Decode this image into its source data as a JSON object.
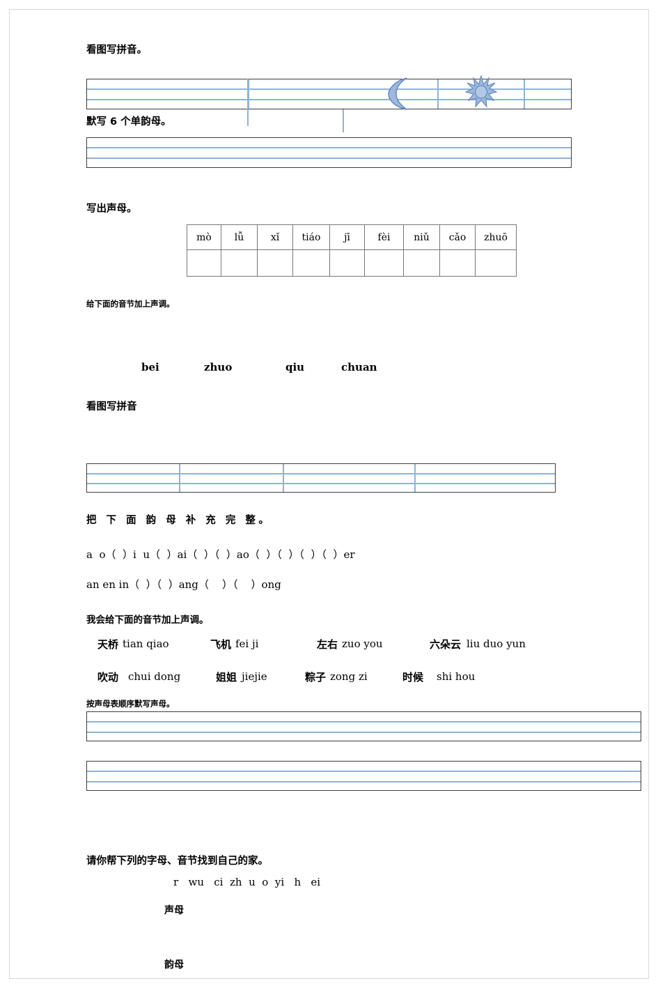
{
  "document": {
    "title": "一年级拼音练习题",
    "page_background": "#ffffff",
    "grid_line_color": "#8db3de",
    "grid_border_color": "#3c3c3c",
    "table_border_color": "#777777",
    "artwork_color": "#9cb8dc"
  },
  "sections": {
    "s1_heading": "看图写拼音。",
    "s2_heading": "默写 6 个单韵母。",
    "s3_heading": "写出声母。",
    "s4_heading": "给下面的音节加上声调。",
    "s5_heading": "看图写拼音",
    "s6_heading": "把 下 面 韵 母 补 充 完 整。",
    "s7_heading": "我会给下面的音节加上声调。",
    "s8_heading": "按声母表顺序默写声母。",
    "s9_heading": "请你帮下列的字母、音节找到自己的家。"
  },
  "pinyin_table": {
    "syllables": [
      "mò",
      "lǚ",
      "xǐ",
      "tiáo",
      "jī",
      "fèi",
      "niǔ",
      "cǎo",
      "zhuō"
    ],
    "answer_row": [
      "",
      "",
      "",
      "",
      "",
      "",
      "",
      "",
      ""
    ]
  },
  "tone_exercise_1": {
    "items": [
      "bei",
      "zhuo",
      "qiu",
      "chuan"
    ]
  },
  "finals_completion": {
    "line1": "a  o（  ）i  u（  ）ai（  ）（  ）ao（  ）（  ）（  ）（  ）er",
    "line2": "an en in（  ）（  ）ang（    ）（    ）ong"
  },
  "tone_exercise_2": {
    "row1": [
      {
        "word": "天桥",
        "pinyin": "tian qiao"
      },
      {
        "word": "飞机",
        "pinyin": "fei ji"
      },
      {
        "word": "左右",
        "pinyin": "zuo you"
      },
      {
        "word": "六朵云",
        "pinyin": "liu duo yun"
      }
    ],
    "row2": [
      {
        "word": "吹动",
        "pinyin": "chui dong"
      },
      {
        "word": "姐姐",
        "pinyin": "jiejie"
      },
      {
        "word": "粽子",
        "pinyin": "zong zi"
      },
      {
        "word": "时候",
        "pinyin": "shi hou"
      }
    ]
  },
  "sorting_exercise": {
    "letters": [
      "r",
      "wu",
      "ci",
      "zh",
      "u",
      "o",
      "yi",
      "h",
      "ei"
    ],
    "letters_line": "r   wu   ci  zh  u  o  yi   h   ei",
    "category_initials": "声母",
    "category_finals": "韵母"
  },
  "artwork": {
    "moon": "crescent-moon-icon",
    "sun": "sun-star-icon"
  }
}
